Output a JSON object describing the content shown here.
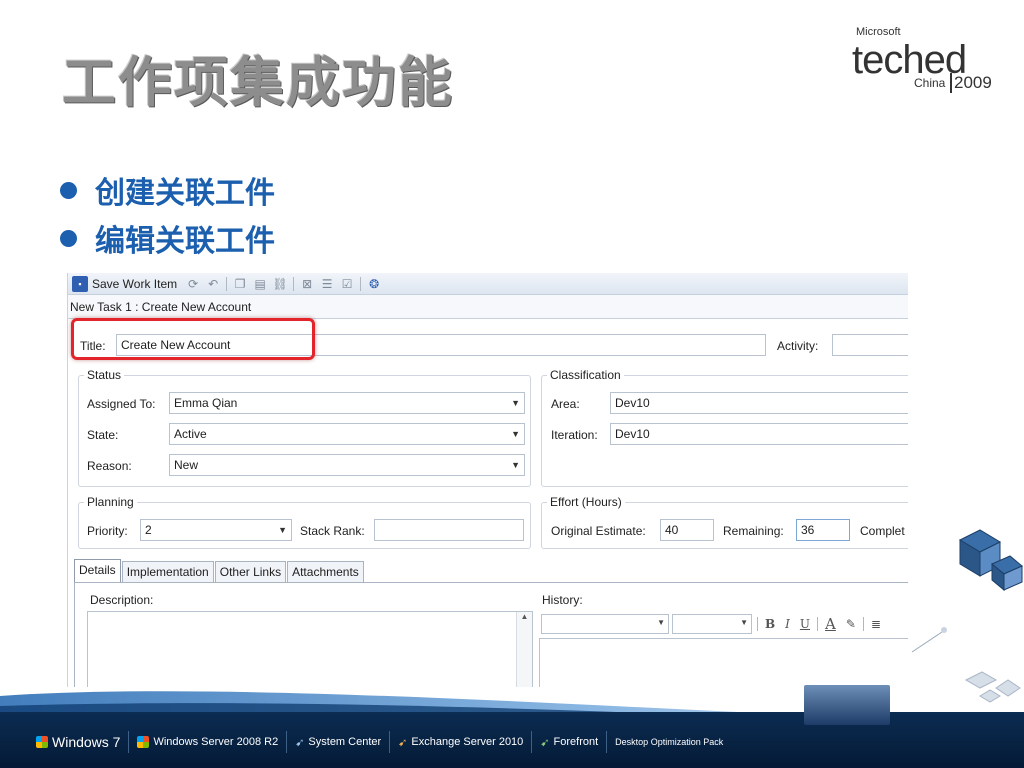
{
  "slide": {
    "title": "工作项集成功能",
    "bullets": [
      "创建关联工件",
      "编辑关联工件"
    ]
  },
  "logo": {
    "brand": "Microsoft",
    "event": "teched",
    "region": "China",
    "year": "2009"
  },
  "toolbar": {
    "save_label": "Save Work Item",
    "icons": [
      "save-icon",
      "refresh-icon",
      "undo-icon",
      "copy-icon",
      "paste-icon",
      "link-icon",
      "link-remove-icon",
      "queries-icon",
      "check-icon",
      "help-icon"
    ]
  },
  "work_item": {
    "window_title": "New Task 1 : Create New Account",
    "title_label": "Title:",
    "title_value": "Create New Account",
    "activity_label": "Activity:",
    "activity_value": "",
    "status": {
      "group_label": "Status",
      "assigned_to_label": "Assigned To:",
      "assigned_to_value": "Emma Qian",
      "state_label": "State:",
      "state_value": "Active",
      "reason_label": "Reason:",
      "reason_value": "New"
    },
    "classification": {
      "group_label": "Classification",
      "area_label": "Area:",
      "area_value": "Dev10",
      "iteration_label": "Iteration:",
      "iteration_value": "Dev10"
    },
    "planning": {
      "group_label": "Planning",
      "priority_label": "Priority:",
      "priority_value": "2",
      "stack_rank_label": "Stack Rank:",
      "stack_rank_value": ""
    },
    "effort": {
      "group_label": "Effort (Hours)",
      "original_estimate_label": "Original Estimate:",
      "original_estimate_value": "40",
      "remaining_label": "Remaining:",
      "remaining_value": "36",
      "completed_label": "Complet"
    },
    "tabs": [
      "Details",
      "Implementation",
      "Other Links",
      "Attachments"
    ],
    "active_tab": "Details",
    "description_label": "Description:",
    "history_label": "History:",
    "rte_buttons": [
      "B",
      "I",
      "U",
      "A"
    ]
  },
  "products": [
    "Windows 7",
    "Windows Server 2008 R2",
    "System Center",
    "Exchange Server 2010",
    "Forefront",
    "Desktop Optimization Pack"
  ],
  "colors": {
    "accent": "#1b5fae",
    "highlight": "#e3242b",
    "band": "#0c2c52"
  }
}
